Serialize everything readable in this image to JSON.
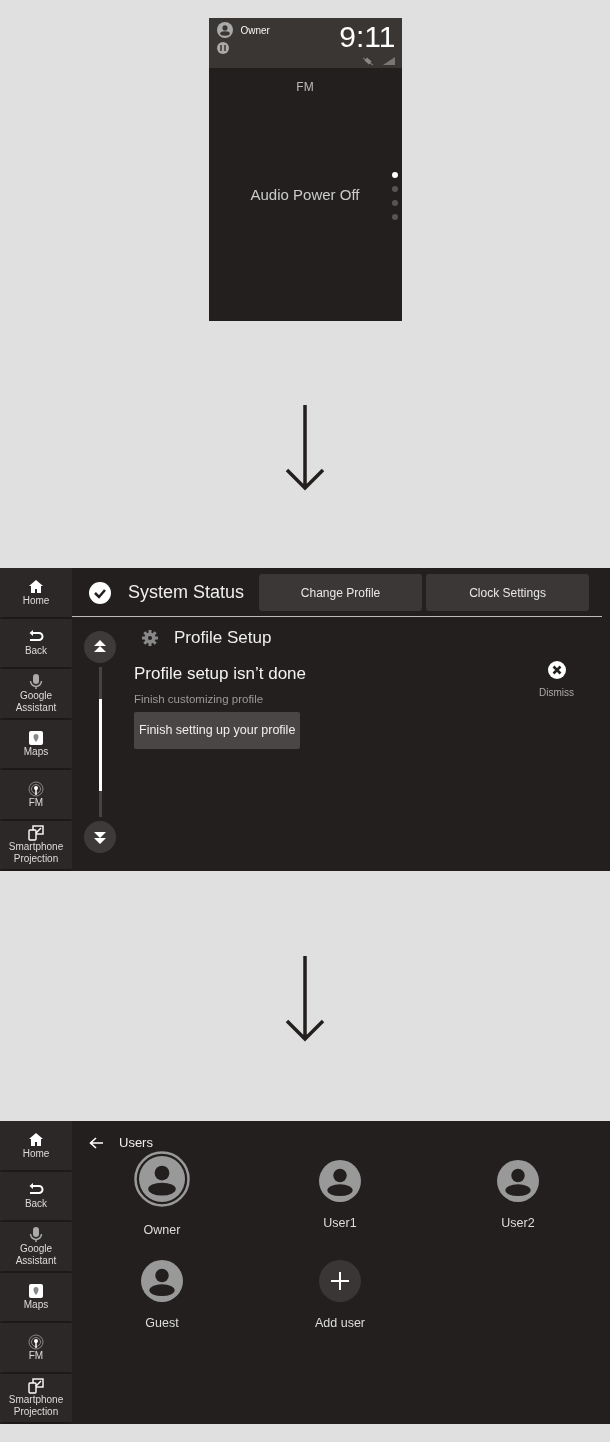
{
  "audio_screen": {
    "user": "Owner",
    "clock": "9:11",
    "source": "FM",
    "message": "Audio Power Off",
    "pages": [
      {
        "selected": true
      },
      {
        "selected": false
      },
      {
        "selected": false
      },
      {
        "selected": false
      }
    ]
  },
  "status_screen": {
    "sidebar": [
      {
        "kind": "home",
        "label": "Home"
      },
      {
        "kind": "back",
        "label": "Back"
      },
      {
        "kind": "mic",
        "label": "Google Assistant"
      },
      {
        "kind": "maps",
        "label": "Maps"
      },
      {
        "kind": "fm",
        "label": "FM"
      },
      {
        "kind": "projection",
        "label": "Smartphone Projection"
      }
    ],
    "title": "System Status",
    "tabs": [
      "Change Profile",
      "Clock Settings"
    ],
    "section": "Profile Setup",
    "heading": "Profile setup isn’t done",
    "subtitle": "Finish customizing profile",
    "action": "Finish setting up your profile",
    "dismiss": "Dismiss"
  },
  "users_screen": {
    "sidebar": [
      {
        "kind": "home",
        "label": "Home"
      },
      {
        "kind": "back",
        "label": "Back"
      },
      {
        "kind": "mic",
        "label": "Google Assistant"
      },
      {
        "kind": "maps",
        "label": "Maps"
      },
      {
        "kind": "fm",
        "label": "FM"
      },
      {
        "kind": "projection",
        "label": "Smartphone Projection"
      }
    ],
    "title": "Users",
    "users": [
      {
        "kind": "user",
        "name": "Owner",
        "selected": true
      },
      {
        "kind": "user",
        "name": "User1",
        "selected": false
      },
      {
        "kind": "user",
        "name": "User2",
        "selected": false
      },
      {
        "kind": "user",
        "name": "Guest",
        "selected": false
      },
      {
        "kind": "add",
        "name": "Add user"
      }
    ]
  }
}
